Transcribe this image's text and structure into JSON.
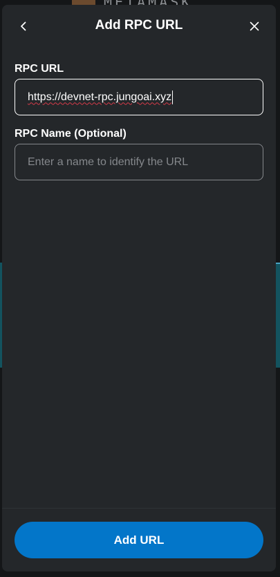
{
  "background": {
    "brand_wordmark": "METAMASK",
    "band_color": "#13535f"
  },
  "dialog": {
    "title": "Add RPC URL",
    "back_icon": "chevron-left-icon",
    "close_icon": "close-icon"
  },
  "form": {
    "rpc_url": {
      "label": "RPC URL",
      "value": "https://devnet-rpc.jungoai.xyz"
    },
    "rpc_name": {
      "label": "RPC Name (Optional)",
      "value": "",
      "placeholder": "Enter a name to identify the URL"
    }
  },
  "footer": {
    "submit_label": "Add URL"
  },
  "colors": {
    "modal_bg": "#24272a",
    "primary": "#0376c9",
    "text": "#ffffff",
    "muted": "#85888c",
    "spellcheck": "#d73a49"
  }
}
